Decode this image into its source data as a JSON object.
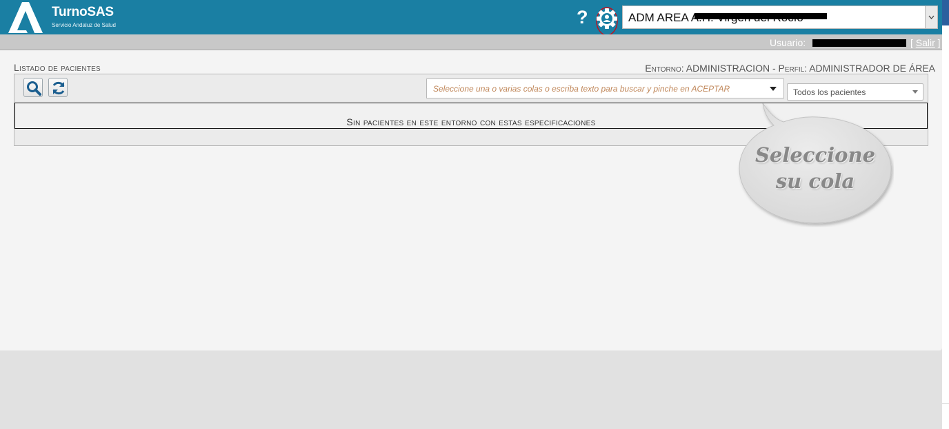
{
  "header": {
    "brand": "TurnoSAS",
    "subtitle": "Servicio Andaluz de Salud",
    "help_label": "?",
    "environment_select_value": "ADM AREA A.H. Virgen del Rocío"
  },
  "userbar": {
    "usuario_label": "Usuario:",
    "salir_label": "Salir"
  },
  "main": {
    "list_title": "Listado de pacientes",
    "environment_info": "Entorno: ADMINISTRACION - Perfil: ADMINISTRADOR DE ÁREA",
    "queue_placeholder": "Seleccione una o varias colas o escriba texto para buscar y pinche en ACEPTAR",
    "patient_filter_value": "Todos los pacientes",
    "empty_message": "Sin pacientes en este entorno con estas especificaciones"
  },
  "callout": {
    "line1": "Seleccione",
    "line2": "su cola"
  },
  "colors": {
    "header_bg": "#1a7fa3",
    "accent_icon": "#1b5e8f",
    "annotation_red": "#c0101e"
  },
  "icons": [
    "logo-a-icon",
    "help-icon",
    "gear-user-icon",
    "search-icon",
    "refresh-icon",
    "chevron-down-icon"
  ]
}
